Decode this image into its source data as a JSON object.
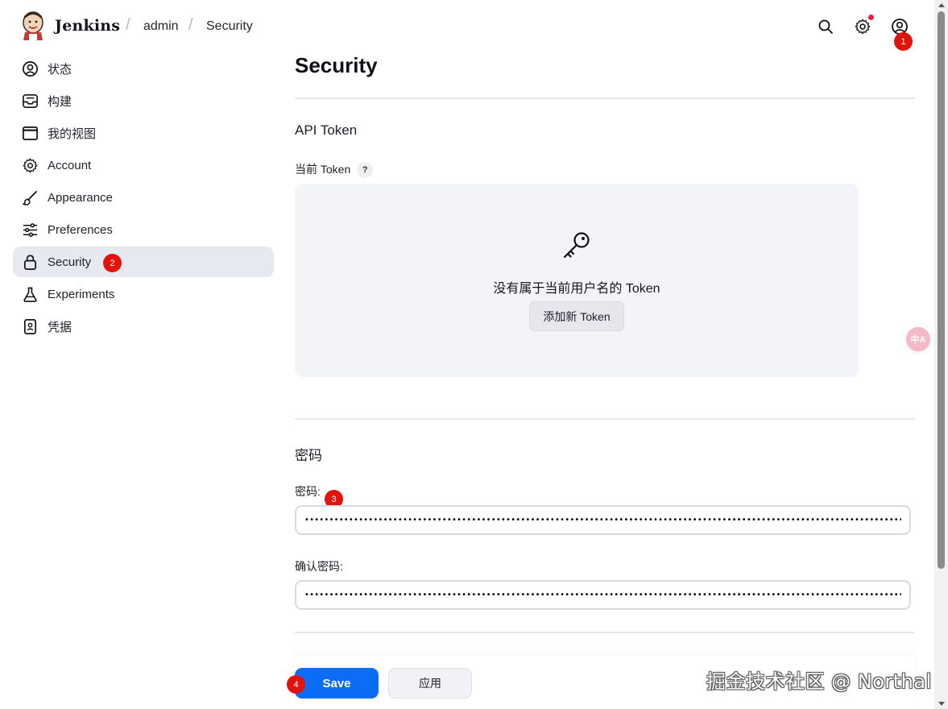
{
  "header": {
    "brand": "Jenkins",
    "breadcrumbs": [
      "admin",
      "Security"
    ],
    "separator": "/",
    "icons": [
      "search-icon",
      "settings-icon",
      "user-account-icon"
    ],
    "notification_color": "#e8203c"
  },
  "markers": [
    "1",
    "2",
    "3",
    "4"
  ],
  "sidebar": {
    "items": [
      {
        "label": "状态",
        "icon": "user-circle-icon"
      },
      {
        "label": "构建",
        "icon": "inbox-icon"
      },
      {
        "label": "我的视图",
        "icon": "window-icon"
      },
      {
        "label": "Account",
        "icon": "gear-icon"
      },
      {
        "label": "Appearance",
        "icon": "brush-icon"
      },
      {
        "label": "Preferences",
        "icon": "sliders-icon"
      },
      {
        "label": "Security",
        "icon": "lock-icon",
        "active": true
      },
      {
        "label": "Experiments",
        "icon": "flask-icon"
      },
      {
        "label": "凭据",
        "icon": "credentials-icon"
      }
    ]
  },
  "main": {
    "title": "Security",
    "api_token": {
      "section_title": "API Token",
      "current_label": "当前 Token",
      "help": "?",
      "empty_text": "没有属于当前用户名的 Token",
      "add_button": "添加新 Token"
    },
    "password": {
      "section_title": "密码",
      "password_label": "密码:",
      "confirm_label": "确认密码:",
      "password_value": "••••••••••••••••••••••••••••••••••••••••••••••••••••••••••••••••••••••••••••••••••••••••••••••••••••••••••••••••••••••••••••••••••",
      "confirm_value": "••••••••••••••••••••••••••••••••••••••••••••••••••••••••••••••••••••••••••••••••••••••••••••••••••••••••••••••••••••••••••••••••••"
    },
    "actions": {
      "save": "Save",
      "apply": "应用"
    }
  },
  "translate_bubble": "中A",
  "watermark": "掘金技术社区 @ Northal",
  "colors": {
    "accent": "#0b6cf5",
    "marker": "#e1140b",
    "active_bg": "#e7e9f0"
  }
}
